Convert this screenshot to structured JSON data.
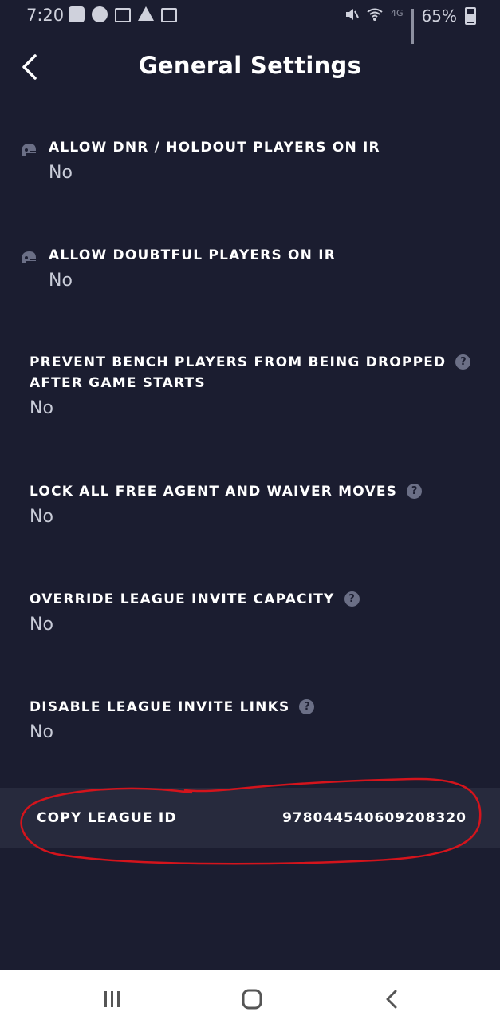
{
  "status_bar": {
    "time": "7:20",
    "battery": "65%",
    "network": "4G",
    "icons": [
      "messenger-icon",
      "nfc-icon",
      "mail-icon",
      "alert-icon",
      "cast-icon",
      "mute-icon",
      "wifi-icon",
      "signal-icon",
      "battery-icon"
    ]
  },
  "header": {
    "title": "General Settings",
    "back_icon": "chevron-left-icon"
  },
  "settings": [
    {
      "title": "ALLOW DNR / HOLDOUT PLAYERS ON IR",
      "value": "No",
      "icon": "helmet-icon"
    },
    {
      "title": "ALLOW DOUBTFUL PLAYERS ON IR",
      "value": "No",
      "icon": "helmet-icon"
    },
    {
      "title_line1": "PREVENT BENCH PLAYERS FROM BEING DROPPED",
      "title_line2": "AFTER GAME STARTS",
      "value": "No",
      "icon": "help-icon"
    },
    {
      "title": "LOCK ALL FREE AGENT AND WAIVER MOVES",
      "value": "No",
      "icon": "help-icon"
    },
    {
      "title": "OVERRIDE LEAGUE INVITE CAPACITY",
      "value": "No",
      "icon": "help-icon"
    },
    {
      "title": "DISABLE LEAGUE INVITE LINKS",
      "value": "No",
      "icon": "help-icon"
    }
  ],
  "help_glyph": "?",
  "copy_league": {
    "label": "COPY LEAGUE ID",
    "value": "978044540609208320"
  },
  "nav_bar": {
    "buttons": [
      "recents-icon",
      "home-icon",
      "back-icon"
    ]
  },
  "colors": {
    "background": "#1b1d30",
    "row_highlight": "#272a3d",
    "annotation": "#d4141c"
  }
}
